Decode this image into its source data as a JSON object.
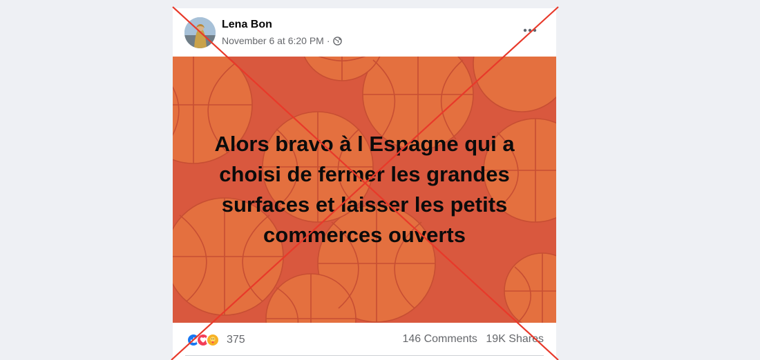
{
  "post": {
    "author": "Lena Bon",
    "timestamp": "November 6 at 6:20 PM",
    "separator": "·",
    "audience_icon": "globe-icon",
    "image_lines": [
      "Alors bravo à l Espagne qui a",
      "choisi de fermer les grandes",
      "surfaces et laisser les petits",
      "commerces ouverts"
    ],
    "reactions": {
      "icons": [
        "like-icon",
        "love-icon",
        "care-icon"
      ],
      "count": "375"
    },
    "comments": "146 Comments",
    "shares": "19K Shares"
  },
  "colors": {
    "image_background": "#d9583e",
    "cross": "#e8392a",
    "like": "#1877f2",
    "love": "#f33e58",
    "care": "#f7b125"
  }
}
